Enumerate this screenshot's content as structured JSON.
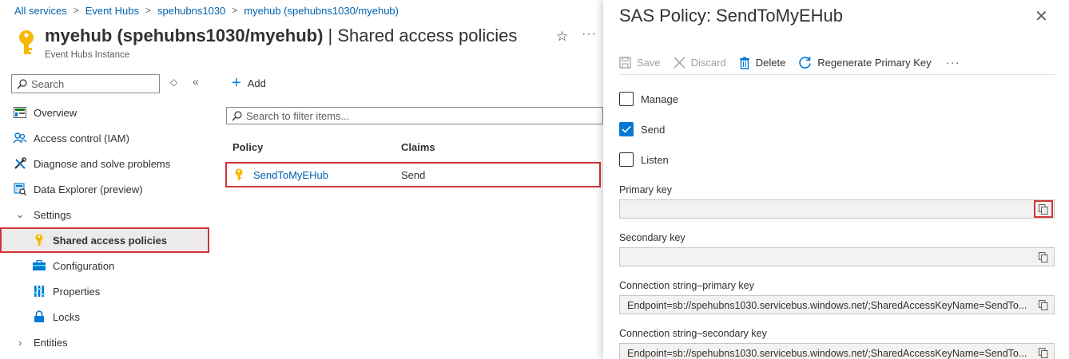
{
  "breadcrumb": {
    "items": [
      "All services",
      "Event Hubs",
      "spehubns1030",
      "myehub (spehubns1030/myehub)"
    ]
  },
  "header": {
    "title_strong": "myehub (spehubns1030/myehub)",
    "title_rest": " | Shared access policies",
    "subtitle": "Event Hubs Instance"
  },
  "sidebar": {
    "search_placeholder": "Search",
    "items": [
      {
        "label": "Overview",
        "icon": "overview-icon"
      },
      {
        "label": "Access control (IAM)",
        "icon": "people-icon"
      },
      {
        "label": "Diagnose and solve problems",
        "icon": "wrench-icon"
      },
      {
        "label": "Data Explorer (preview)",
        "icon": "data-explorer-icon"
      },
      {
        "label": "Settings",
        "icon": "chevron-down-icon"
      },
      {
        "label": "Shared access policies",
        "icon": "key-icon"
      },
      {
        "label": "Configuration",
        "icon": "briefcase-icon"
      },
      {
        "label": "Properties",
        "icon": "properties-icon"
      },
      {
        "label": "Locks",
        "icon": "lock-icon"
      },
      {
        "label": "Entities",
        "icon": "chevron-right-icon"
      }
    ]
  },
  "main": {
    "add_label": "Add",
    "filter_placeholder": "Search to filter items...",
    "columns": [
      "Policy",
      "Claims"
    ],
    "rows": [
      {
        "policy": "SendToMyEHub",
        "claims": "Send"
      }
    ]
  },
  "panel": {
    "title": "SAS Policy: SendToMyEHub",
    "toolbar": {
      "save": "Save",
      "discard": "Discard",
      "delete": "Delete",
      "regenerate": "Regenerate Primary Key"
    },
    "checks": [
      {
        "label": "Manage",
        "checked": false
      },
      {
        "label": "Send",
        "checked": true
      },
      {
        "label": "Listen",
        "checked": false
      }
    ],
    "fields": {
      "primary_key_label": "Primary key",
      "primary_key_value": "",
      "secondary_key_label": "Secondary key",
      "secondary_key_value": "",
      "conn_primary_label": "Connection string–primary key",
      "conn_primary_value": "Endpoint=sb://spehubns1030.servicebus.windows.net/;SharedAccessKeyName=SendTo...",
      "conn_secondary_label": "Connection string–secondary key",
      "conn_secondary_value": "Endpoint=sb://spehubns1030.servicebus.windows.net/;SharedAccessKeyName=SendTo..."
    }
  },
  "colors": {
    "accent": "#0078d4",
    "link": "#0063b1",
    "highlight": "#d13438",
    "key_yellow": "#f7b900"
  }
}
